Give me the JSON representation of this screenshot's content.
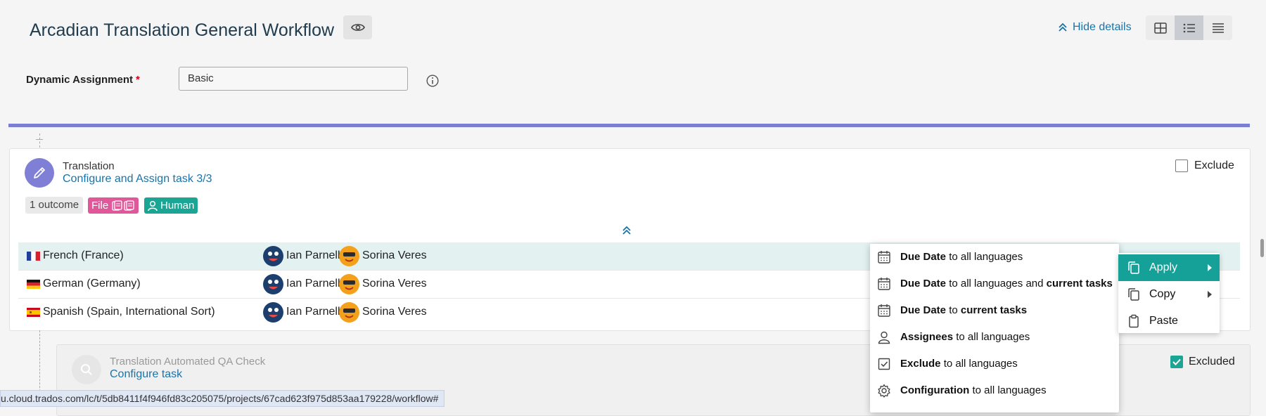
{
  "header": {
    "title": "Arcadian Translation General Workflow",
    "hide_details": "Hide details"
  },
  "dynamic_assignment": {
    "label": "Dynamic Assignment",
    "required_marker": "*",
    "value": "Basic"
  },
  "task": {
    "name": "Translation",
    "link": "Configure and Assign task 3/3",
    "outcome_badge": "1 outcome",
    "file_badge": "File",
    "human_badge": "Human",
    "exclude_label": "Exclude",
    "languages": [
      {
        "name": "French (France)",
        "flag": "fr",
        "assignees": [
          "Ian Parnell",
          "Sorina Veres"
        ]
      },
      {
        "name": "German (Germany)",
        "flag": "de",
        "assignees": [
          "Ian Parnell",
          "Sorina Veres"
        ]
      },
      {
        "name": "Spanish (Spain, International Sort)",
        "flag": "es",
        "assignees": [
          "Ian Parnell",
          "Sorina Veres"
        ]
      }
    ]
  },
  "qa_task": {
    "name": "Translation Automated QA Check",
    "link": "Configure task",
    "excluded_label": "Excluded"
  },
  "context_menu": {
    "items": [
      {
        "bold": "Due Date",
        "rest": " to all languages",
        "bold2": "",
        "icon": "calendar-icon"
      },
      {
        "bold": "Due Date",
        "rest": " to all languages and ",
        "bold2": "current tasks",
        "icon": "calendar-icon"
      },
      {
        "bold": "Due Date",
        "rest": " to ",
        "bold2": "current tasks",
        "icon": "calendar-icon"
      },
      {
        "bold": "Assignees",
        "rest": " to all languages",
        "bold2": "",
        "icon": "person-icon"
      },
      {
        "bold": "Exclude",
        "rest": " to all languages",
        "bold2": "",
        "icon": "checkbox-icon"
      },
      {
        "bold": "Configuration",
        "rest": " to all languages",
        "bold2": "",
        "icon": "gear-icon"
      }
    ]
  },
  "sub_menu": {
    "apply": "Apply",
    "copy": "Copy",
    "paste": "Paste"
  },
  "status_bar": {
    "url": "u.cloud.trados.com/lc/t/5db8411f4f946fd83c205075/projects/67cad623f975d853aa179228/workflow#"
  },
  "colors": {
    "accent_teal": "#1aa595",
    "link_blue": "#1a73a8",
    "purple": "#7b7fd4",
    "file_pink": "#e0579a"
  }
}
